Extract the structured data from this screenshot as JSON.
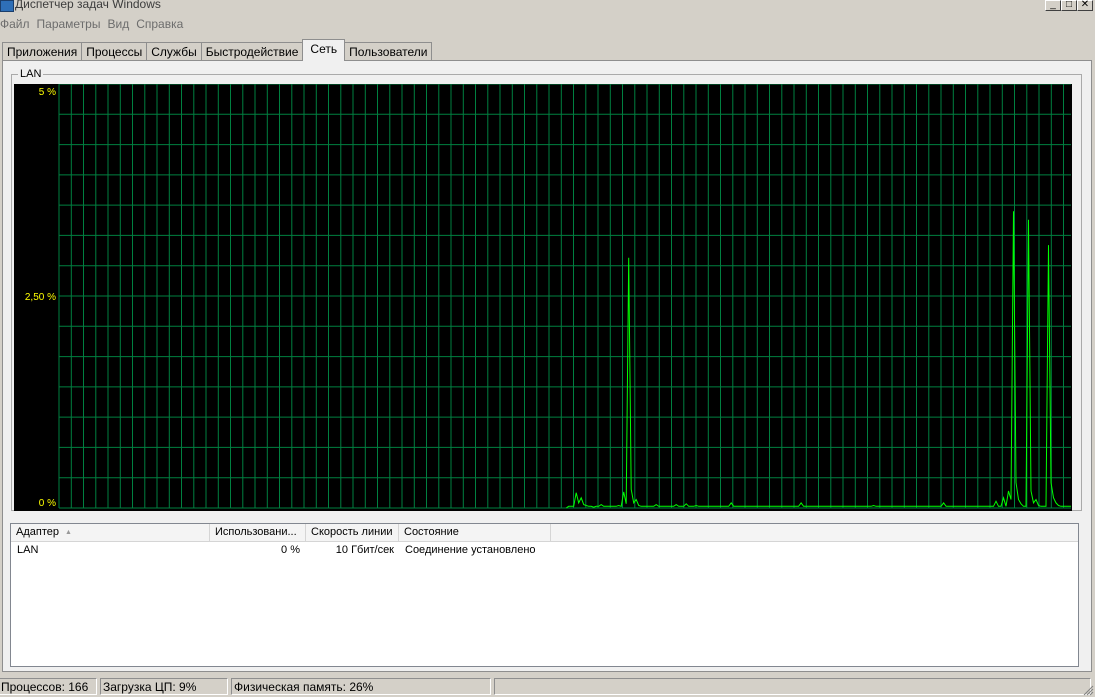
{
  "window": {
    "title": "Диспетчер задач Windows",
    "buttons": [
      {
        "name": "minimize-button",
        "glyph": "_"
      },
      {
        "name": "maximize-button",
        "glyph": "□"
      },
      {
        "name": "close-button",
        "glyph": "✕"
      }
    ]
  },
  "menu": [
    "Файл",
    "Параметры",
    "Вид",
    "Справка"
  ],
  "tabs": [
    {
      "label": "Приложения",
      "active": false
    },
    {
      "label": "Процессы",
      "active": false
    },
    {
      "label": "Службы",
      "active": false
    },
    {
      "label": "Быстродействие",
      "active": false
    },
    {
      "label": "Сеть",
      "active": true
    },
    {
      "label": "Пользователи",
      "active": false
    }
  ],
  "graph": {
    "label": "LAN",
    "y_labels": [
      "5 %",
      "2,50 %",
      "0 %"
    ],
    "colors": {
      "grid": "#008040",
      "line": "#00ff00",
      "labels": "#ffff00",
      "background": "#000000"
    }
  },
  "chart_data": {
    "type": "line",
    "ylim": [
      0,
      5
    ],
    "y_ticks": [
      "5 %",
      "2,50 %",
      "0 %"
    ],
    "grid": true,
    "series": [
      {
        "values": [
          0,
          0,
          0,
          0,
          0,
          0,
          0,
          0,
          0,
          0,
          0,
          0,
          0,
          0,
          0,
          0,
          0,
          0,
          0,
          0,
          0,
          0,
          0,
          0,
          0,
          0,
          0,
          0,
          0,
          0,
          0,
          0,
          0,
          0,
          0,
          0,
          0,
          0,
          0,
          0,
          0,
          0,
          0,
          0,
          0,
          0,
          0,
          0,
          0,
          0,
          0,
          0,
          0,
          0,
          0,
          0,
          0,
          0,
          0,
          0,
          0,
          0,
          0,
          0,
          0,
          0,
          0,
          0,
          0,
          0,
          0,
          0,
          0,
          0,
          0,
          0,
          0,
          0,
          0,
          0,
          0,
          0,
          0,
          0,
          0,
          0,
          0,
          0,
          0,
          0,
          0,
          0,
          0,
          0,
          0,
          0,
          0,
          0,
          0,
          0,
          0,
          0,
          0,
          0,
          0,
          0,
          0,
          0,
          0,
          0,
          0,
          0,
          0,
          0,
          0,
          0,
          0,
          0,
          0,
          0,
          0,
          0,
          0,
          0,
          0,
          0,
          0,
          0,
          0,
          0,
          0,
          0,
          0,
          0,
          0,
          0,
          0,
          0,
          0,
          0,
          0,
          0,
          0,
          0,
          0,
          0,
          0,
          0,
          0,
          0,
          0,
          0,
          0,
          0,
          0,
          0,
          0,
          0,
          0,
          0,
          0,
          0,
          0,
          0,
          0,
          0,
          0,
          0,
          0,
          0,
          0,
          0,
          0,
          0,
          0,
          0,
          0,
          0,
          0,
          0,
          0,
          0,
          0,
          0,
          0,
          0,
          0,
          0,
          0,
          0,
          0,
          0,
          0,
          0,
          0,
          0,
          0,
          0,
          0,
          0,
          0,
          0,
          0,
          0,
          0.02,
          0.02,
          0.02,
          0.18,
          0.06,
          0.12,
          0.04,
          0.03,
          0.02,
          0.02,
          0.01,
          0.02,
          0.02,
          0.04,
          0.02,
          0.02,
          0.02,
          0.02,
          0.02,
          0.02,
          0.03,
          0.02,
          0.19,
          0.05,
          2.95,
          0.22,
          0.06,
          0.1,
          0.03,
          0.02,
          0.02,
          0.02,
          0.02,
          0.02,
          0.02,
          0.04,
          0.02,
          0.02,
          0.02,
          0.02,
          0.02,
          0.02,
          0.02,
          0.04,
          0.02,
          0.02,
          0.02,
          0.05,
          0.02,
          0.02,
          0.02,
          0.03,
          0.02,
          0.02,
          0.02,
          0.02,
          0.02,
          0.02,
          0.02,
          0.02,
          0.02,
          0.02,
          0.02,
          0.02,
          0.02,
          0.06,
          0.02,
          0.02,
          0.02,
          0.02,
          0.02,
          0.02,
          0.02,
          0.02,
          0.02,
          0.02,
          0.02,
          0.02,
          0.02,
          0.02,
          0.02,
          0.02,
          0.02,
          0.02,
          0.02,
          0.02,
          0.02,
          0.02,
          0.02,
          0.02,
          0.02,
          0.02,
          0.02,
          0.06,
          0.02,
          0.02,
          0.02,
          0.02,
          0.02,
          0.02,
          0.02,
          0.02,
          0.02,
          0.02,
          0.02,
          0.02,
          0.02,
          0.02,
          0.02,
          0.02,
          0.02,
          0.02,
          0.02,
          0.02,
          0.02,
          0.02,
          0.02,
          0.02,
          0.02,
          0.02,
          0.02,
          0.02,
          0.03,
          0.02,
          0.02,
          0.02,
          0.02,
          0.02,
          0.02,
          0.02,
          0.02,
          0.02,
          0.02,
          0.02,
          0.02,
          0.02,
          0.02,
          0.02,
          0.02,
          0.02,
          0.02,
          0.02,
          0.02,
          0.02,
          0.02,
          0.02,
          0.02,
          0.02,
          0.02,
          0.02,
          0.06,
          0.02,
          0.02,
          0.02,
          0.02,
          0.02,
          0.02,
          0.02,
          0.02,
          0.02,
          0.02,
          0.02,
          0.02,
          0.02,
          0.02,
          0.02,
          0.02,
          0.02,
          0.02,
          0.02,
          0.02,
          0.08,
          0.02,
          0.02,
          0.12,
          0.02,
          0.2,
          0.1,
          3.5,
          0.3,
          0.1,
          0.05,
          0.02,
          0.02,
          3.4,
          0.2,
          0.06,
          0.1,
          0.03,
          0.02,
          0.02,
          0.02,
          3.1,
          0.3,
          0.12,
          0.06,
          0.03,
          0.02,
          0.02,
          0.02,
          0.02,
          0.02
        ]
      }
    ]
  },
  "table": {
    "columns": [
      "Адаптер",
      "Использовани...",
      "Скорость линии",
      "Состояние"
    ],
    "rows": [
      {
        "adapter": "LAN",
        "usage": "0 %",
        "speed": "10 Гбит/сек",
        "state": "Соединение установлено"
      }
    ]
  },
  "status": {
    "processes": "Процессов: 166",
    "cpu": "Загрузка ЦП: 9%",
    "memory": "Физическая память: 26%"
  }
}
